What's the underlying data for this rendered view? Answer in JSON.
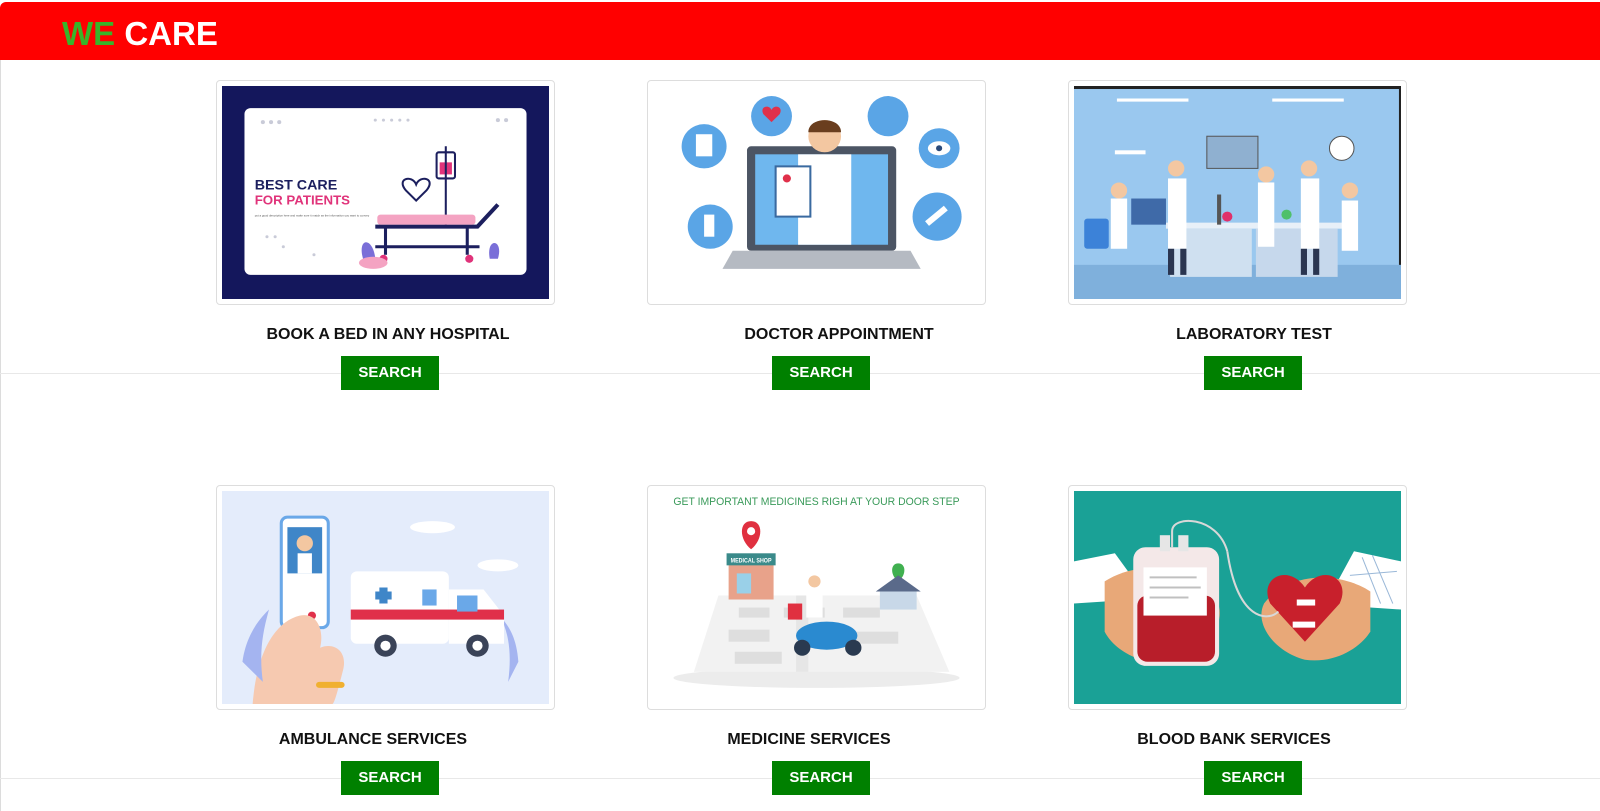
{
  "brand": {
    "we": "WE",
    "care": "CARE"
  },
  "colors": {
    "header": "#ff0000",
    "brand_accent": "#38b52a",
    "button": "#008000"
  },
  "services": [
    {
      "title": "BOOK A BED IN ANY HOSPITAL",
      "button": "SEARCH",
      "image_title": "BEST CARE",
      "image_subtitle": "FOR PATIENTS",
      "image_caption": "put a good description here and make sure it match as the information you want to convey"
    },
    {
      "title": "DOCTOR APPOINTMENT",
      "button": "SEARCH"
    },
    {
      "title": "LABORATORY TEST",
      "button": "SEARCH"
    },
    {
      "title": "AMBULANCE SERVICES",
      "button": "SEARCH"
    },
    {
      "title": "MEDICINE SERVICES",
      "button": "SEARCH",
      "image_title": "GET IMPORTANT MEDICINES RIGH AT YOUR DOOR STEP",
      "image_sign": "MEDICAL SHOP"
    },
    {
      "title": "BLOOD BANK SERVICES",
      "button": "SEARCH"
    }
  ]
}
